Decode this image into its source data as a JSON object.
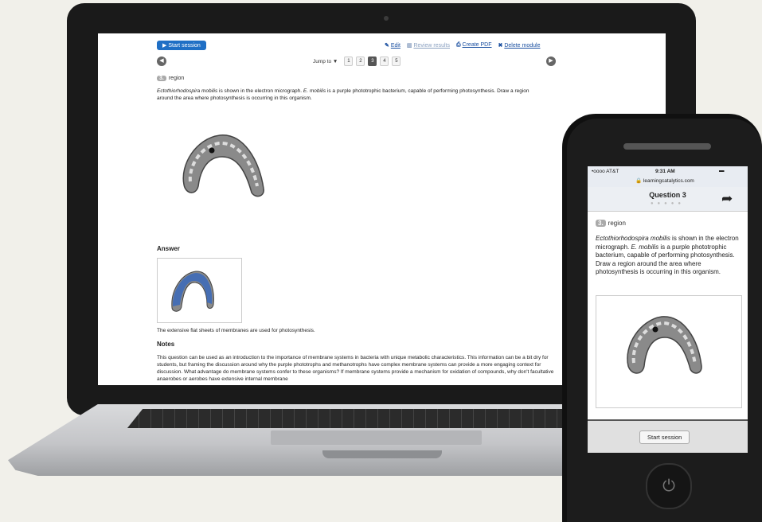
{
  "laptop": {
    "toolbar": {
      "start_session": "Start session",
      "edit": "Edit",
      "review_results": "Review results",
      "create_pdf": "Create PDF",
      "delete_module": "Delete module"
    },
    "nav": {
      "jump_to": "Jump to ▼",
      "pages": [
        "1",
        "2",
        "3",
        "4",
        "5"
      ],
      "current_page": "3"
    },
    "question": {
      "number": "3.",
      "type": "region",
      "species": "Ectothiorhodospira mobilis",
      "text_1": " is shown in the electron micrograph. ",
      "species_short": "E. mobilis",
      "text_2": " is a purple phototrophic bacterium, capable of performing photosynthesis. Draw a region around the area where photosynthesis is occurring in this organism."
    },
    "answer": {
      "heading": "Answer",
      "explanation": "The extensive flat sheets of membranes are used for photosynthesis."
    },
    "notes": {
      "heading": "Notes",
      "text": "This question can be used as an introduction to the importance of membrane systems in bacteria with unique metabolic characteristics. This information can be a bit dry for students, but framing the discussion around why the purple phototrophs and methanotrophs have complex membrane systems can provide a more engaging context for discussion. What advantage do membrane systems confer to these organisms? If membrane systems provide a mechanism for oxidation of compounds, why don't facultative anaerobes or aerobes have extensive internal membrane"
    }
  },
  "phone": {
    "status": {
      "carrier": "•oooo AT&T",
      "time": "9:31 AM",
      "url": "learningcatalytics.com"
    },
    "title": "Question 3",
    "dots": "●●●●●",
    "question": {
      "number": "3.",
      "type": "region",
      "species": "Ectothiorhodospira mobilis",
      "text_1": " is shown in the electron micrograph. ",
      "species_short": "E. mobilis",
      "text_2": " is a purple phototrophic bacterium, capable of performing photosynthesis. Draw a region around the area where photosynthesis is occurring in this organism."
    },
    "start_session": "Start session"
  },
  "icons": {
    "edit": "pencil-icon",
    "review": "chart-icon",
    "pdf": "printer-icon",
    "delete": "x-icon",
    "prev": "left-arrow-icon",
    "next": "right-arrow-icon",
    "share": "share-arrow-icon",
    "home": "power-icon"
  }
}
